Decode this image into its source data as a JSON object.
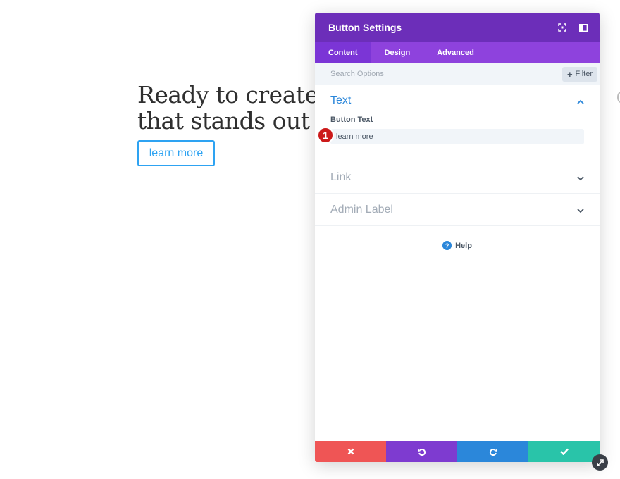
{
  "hero": {
    "heading_line1": "Ready to create a",
    "heading_line2": "that stands out fr",
    "button_label": "learn more"
  },
  "panel": {
    "title": "Button Settings",
    "header_icons": [
      "fullscreen-icon",
      "sidebar-toggle-icon"
    ],
    "tabs": [
      {
        "label": "Content",
        "active": true
      },
      {
        "label": "Design",
        "active": false
      },
      {
        "label": "Advanced",
        "active": false
      }
    ],
    "search": {
      "placeholder": "Search Options",
      "filter_label": "Filter"
    },
    "sections": {
      "text": {
        "title": "Text",
        "field_label": "Button Text",
        "field_value": "learn more",
        "step_badge": "1"
      },
      "link": {
        "title": "Link"
      },
      "admin": {
        "title": "Admin Label"
      }
    },
    "help_label": "Help",
    "footer_icons": [
      "close-icon",
      "undo-icon",
      "redo-icon",
      "check-icon"
    ]
  },
  "colors": {
    "header": "#6c2eb9",
    "tabs": "#8e42dd",
    "accent_blue": "#2b87da",
    "cancel": "#ef5555",
    "undo": "#7e3bd0",
    "redo": "#2b87da",
    "save": "#29c4a9",
    "badge": "#cc1a1a"
  }
}
